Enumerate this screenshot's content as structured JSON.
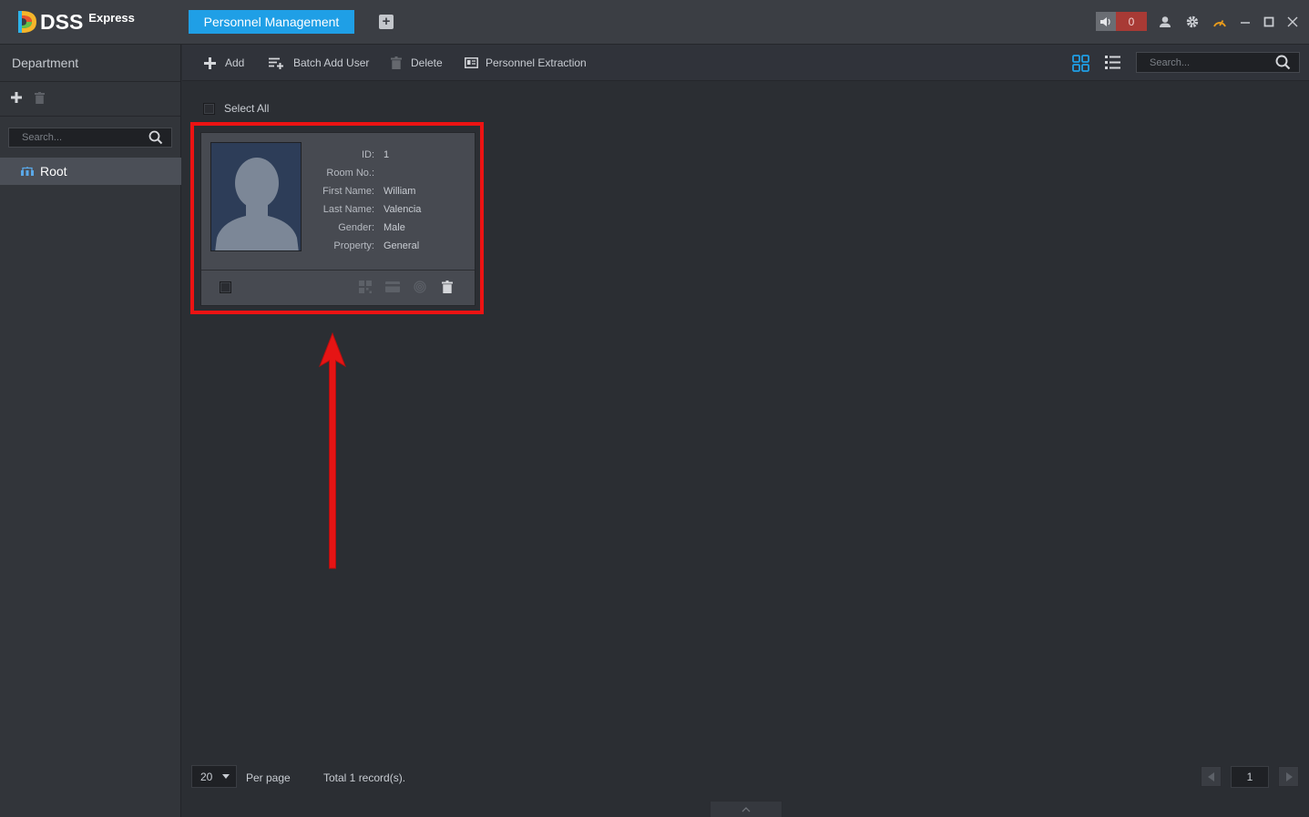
{
  "app": {
    "logo_text": "DSS",
    "logo_sub": "Express"
  },
  "titlebar": {
    "active_tab": "Personnel Management",
    "add_tab_symbol": "+",
    "alarm_count": "0"
  },
  "sidebar": {
    "title": "Department",
    "search_placeholder": "Search...",
    "tree": [
      {
        "label": "Root"
      }
    ]
  },
  "toolbar": {
    "add": "Add",
    "batch_add": "Batch Add User",
    "delete": "Delete",
    "extraction": "Personnel Extraction",
    "search_placeholder": "Search..."
  },
  "main": {
    "select_all": "Select All",
    "card": {
      "fields": [
        {
          "key": "ID:",
          "value": "1"
        },
        {
          "key": "Room No.:",
          "value": ""
        },
        {
          "key": "First Name:",
          "value": "William"
        },
        {
          "key": "Last Name:",
          "value": "Valencia"
        },
        {
          "key": "Gender:",
          "value": "Male"
        },
        {
          "key": "Property:",
          "value": "General"
        }
      ]
    }
  },
  "footer": {
    "per_page_value": "20",
    "per_page_label": "Per page",
    "total": "Total 1 record(s).",
    "page": "1"
  },
  "colors": {
    "accent": "#1f9fe6",
    "highlight": "#ec1313",
    "alarm": "#a83a35"
  }
}
